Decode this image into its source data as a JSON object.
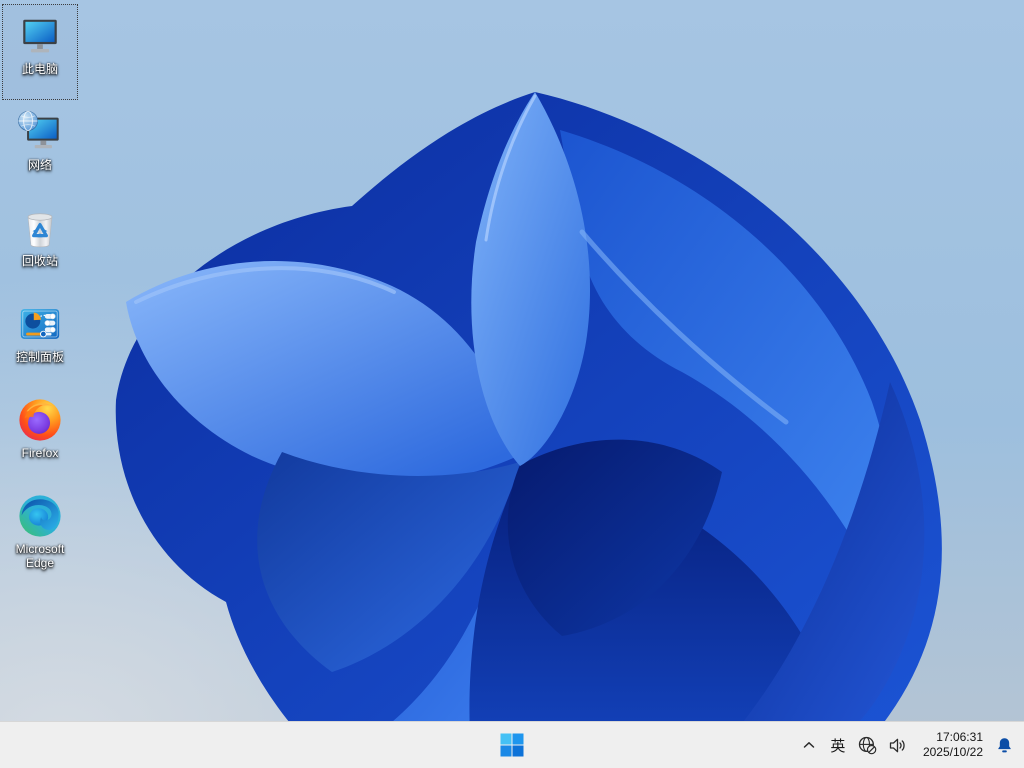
{
  "desktop": {
    "wallpaper": {
      "name": "windows-11-bloom-light",
      "sky_color": "#9fc0de",
      "petal_dark": "#0a2f9e",
      "petal_mid": "#1c55d0",
      "petal_bright": "#4f8cf0"
    },
    "icons": [
      {
        "name": "this-pc",
        "label": "此电脑",
        "selected": true
      },
      {
        "name": "network",
        "label": "网络",
        "selected": false
      },
      {
        "name": "recycle-bin",
        "label": "回收站",
        "selected": false
      },
      {
        "name": "control-panel",
        "label": "控制面板",
        "selected": false
      },
      {
        "name": "firefox",
        "label": "Firefox",
        "selected": false
      },
      {
        "name": "microsoft-edge",
        "label": "Microsoft Edge",
        "selected": false
      }
    ]
  },
  "taskbar": {
    "background": "#efefef",
    "start_logo_colors": [
      "#45c1f5",
      "#1e96ee",
      "#1b89e6",
      "#0d72d8"
    ],
    "tray": {
      "ime": "英",
      "time": "17:06:31",
      "date": "2025/10/22",
      "bell_color": "#0b4da6",
      "icon_names": [
        "chevron-up-icon",
        "network-offline-icon",
        "speaker-icon",
        "notification-bell-icon"
      ]
    }
  }
}
